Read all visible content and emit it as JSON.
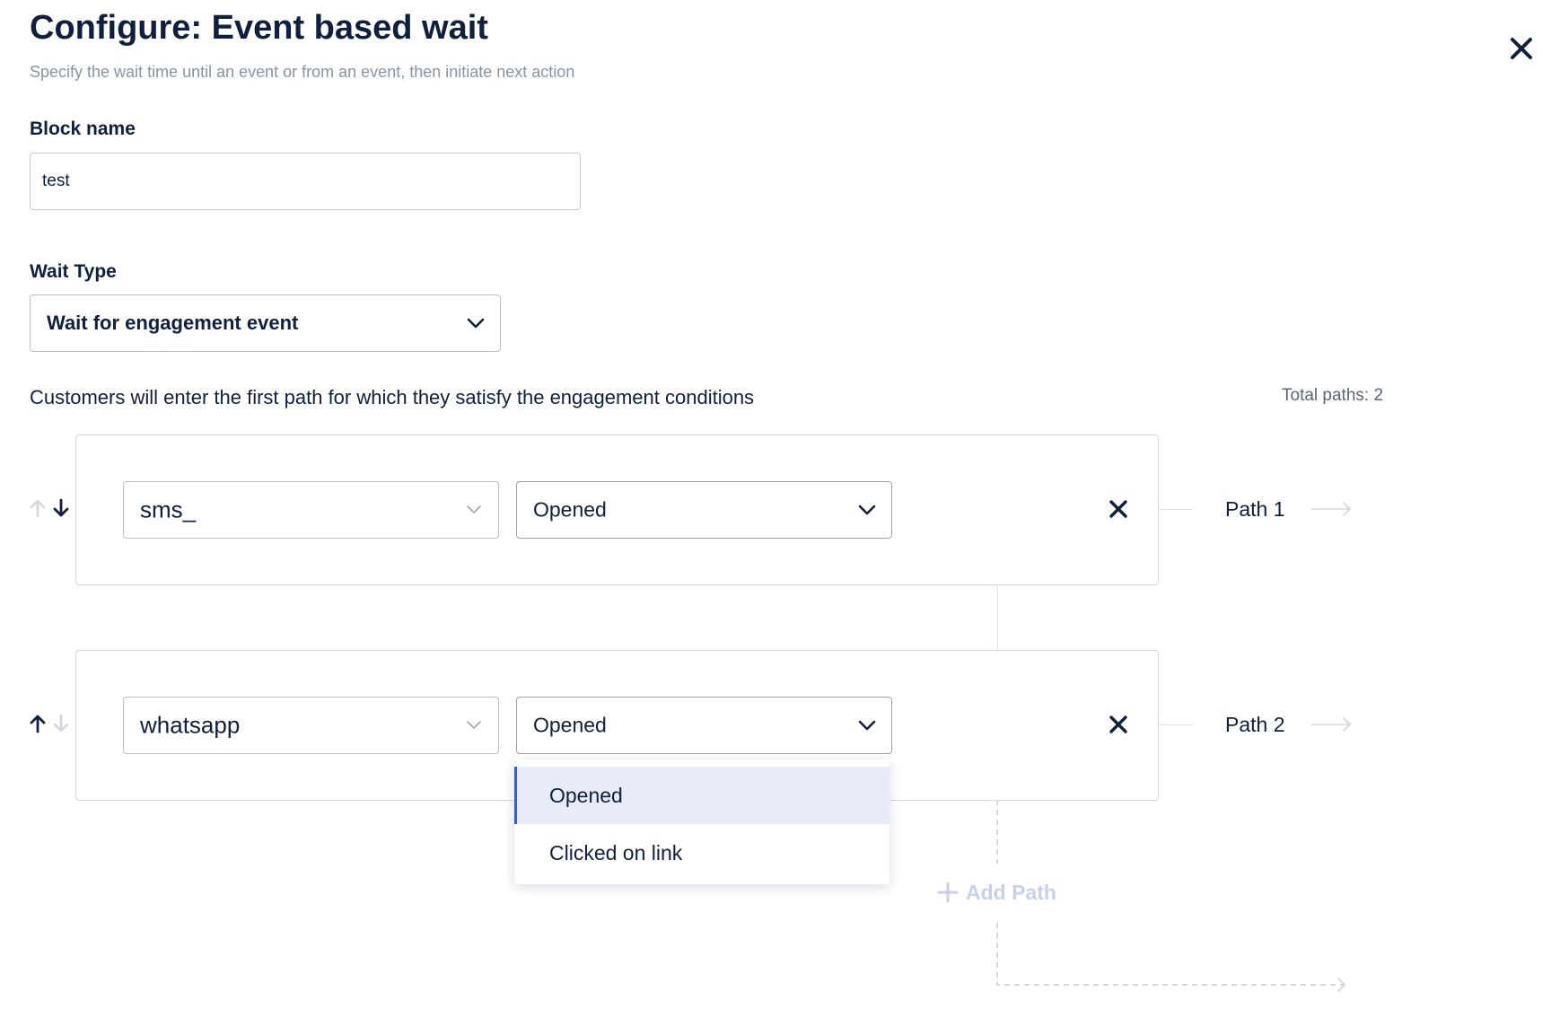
{
  "header": {
    "title": "Configure: Event based wait",
    "subtitle": "Specify the wait time until an event or from an event, then initiate next action"
  },
  "block_name": {
    "label": "Block name",
    "value": "test"
  },
  "wait_type": {
    "label": "Wait Type",
    "selected": "Wait for engagement event"
  },
  "paths_section": {
    "info": "Customers will enter the first path for which they satisfy the engagement conditions",
    "total_paths": "Total paths: 2"
  },
  "paths": [
    {
      "channel": "sms_",
      "event": "Opened",
      "label": "Path 1"
    },
    {
      "channel": "whatsapp",
      "event": "Opened",
      "label": "Path 2"
    }
  ],
  "event_dropdown": {
    "options": [
      "Opened",
      "Clicked on link"
    ],
    "selected": "Opened"
  },
  "add_path_label": "Add Path",
  "colors": {
    "text_primary": "#0f1f3d",
    "text_muted": "#8a93a3",
    "accent": "#3a5bd9",
    "selected_bg": "#e8ecf9",
    "add_path_disabled": "#c6d0ea",
    "border": "#d6dae0"
  }
}
